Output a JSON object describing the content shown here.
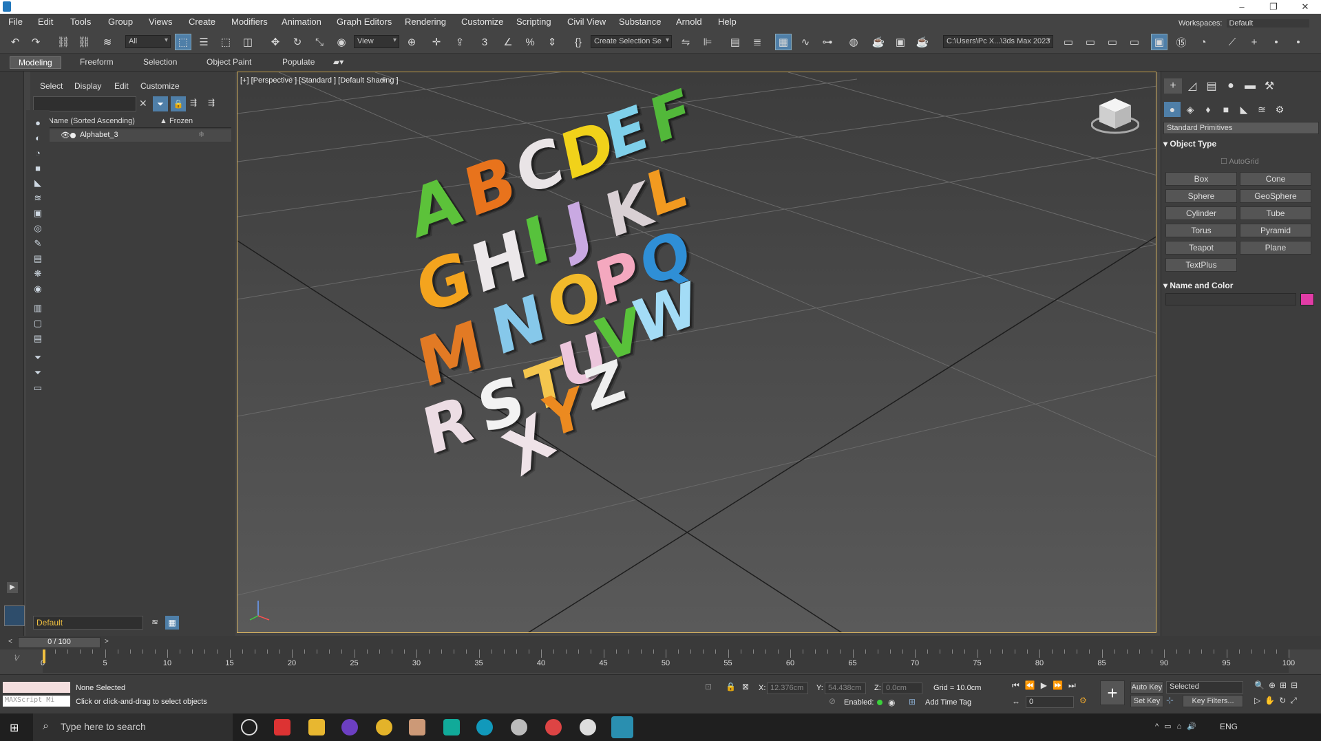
{
  "menubar": {
    "items": [
      "File",
      "Edit",
      "Tools",
      "Group",
      "Views",
      "Create",
      "Modifiers",
      "Animation",
      "Graph Editors",
      "Rendering",
      "Customize",
      "Scripting",
      "Civil View",
      "Substance",
      "Arnold",
      "Help"
    ],
    "workspaces_label": "Workspaces:",
    "workspaces_value": "Default"
  },
  "toolbar": {
    "selection_filter": "All",
    "reference_coord": "View",
    "named_selection": "Create Selection Se",
    "project_path": "C:\\Users\\Pc X...\\3ds Max 2023"
  },
  "ribbon": {
    "tabs": [
      "Modeling",
      "Freeform",
      "Selection",
      "Object Paint",
      "Populate"
    ],
    "active_tab": "Modeling"
  },
  "scene_explorer": {
    "menu": [
      "Select",
      "Display",
      "Edit",
      "Customize"
    ],
    "search_placeholder": "",
    "col_name": "Name (Sorted Ascending)",
    "col_frozen": "▲ Frozen",
    "rows": [
      {
        "name": "Alphabet_3"
      }
    ],
    "layer": "Default"
  },
  "viewport": {
    "label": "[+] [Perspective ] [Standard ] [Default Shading ]",
    "letters": [
      {
        "ch": "A",
        "color": "#5cc23a"
      },
      {
        "ch": "B",
        "color": "#e8731c"
      },
      {
        "ch": "C",
        "color": "#e9e4e6"
      },
      {
        "ch": "D",
        "color": "#f1d21a"
      },
      {
        "ch": "E",
        "color": "#7fd0ea"
      },
      {
        "ch": "F",
        "color": "#52b83a"
      },
      {
        "ch": "G",
        "color": "#f4a41e"
      },
      {
        "ch": "H",
        "color": "#ece8ea"
      },
      {
        "ch": "I",
        "color": "#57c23c"
      },
      {
        "ch": "J",
        "color": "#c9a9e2"
      },
      {
        "ch": "K",
        "color": "#d9d0d4"
      },
      {
        "ch": "L",
        "color": "#f29a20"
      },
      {
        "ch": "M",
        "color": "#e27a24"
      },
      {
        "ch": "N",
        "color": "#86c8ea"
      },
      {
        "ch": "O",
        "color": "#f2ba2a"
      },
      {
        "ch": "P",
        "color": "#f4a8bf"
      },
      {
        "ch": "Q",
        "color": "#2f8fd6"
      },
      {
        "ch": "R",
        "color": "#ecdde4"
      },
      {
        "ch": "S",
        "color": "#f2f2f2"
      },
      {
        "ch": "T",
        "color": "#f4c64e"
      },
      {
        "ch": "U",
        "color": "#ecc6dc"
      },
      {
        "ch": "V",
        "color": "#59c23a"
      },
      {
        "ch": "W",
        "color": "#a3dcf6"
      },
      {
        "ch": "X",
        "color": "#efe3e8"
      },
      {
        "ch": "Y",
        "color": "#ec8a20"
      },
      {
        "ch": "Z",
        "color": "#efefef"
      }
    ]
  },
  "command_panel": {
    "category": "Standard Primitives",
    "object_type_title": "Object Type",
    "autogrid": "AutoGrid",
    "buttons": [
      "Box",
      "Cone",
      "Sphere",
      "GeoSphere",
      "Cylinder",
      "Tube",
      "Torus",
      "Pyramid",
      "Teapot",
      "Plane",
      "TextPlus"
    ],
    "name_color_title": "Name and Color",
    "swatch_color": "#e23ca6"
  },
  "timeline": {
    "frame_display": "0 / 100",
    "ticks": [
      0,
      5,
      10,
      15,
      20,
      25,
      30,
      35,
      40,
      45,
      50,
      55,
      60,
      65,
      70,
      75,
      80,
      85,
      90,
      95,
      100
    ]
  },
  "status": {
    "selection": "None Selected",
    "prompt": "Click or click-and-drag to select objects",
    "maxscript": "MAXScript Mi",
    "x_label": "X:",
    "x_value": "12.376cm",
    "y_label": "Y:",
    "y_value": "54.438cm",
    "z_label": "Z:",
    "z_value": "0.0cm",
    "grid": "Grid = 10.0cm",
    "enabled_label": "Enabled:",
    "add_time_tag": "Add Time Tag",
    "auto_key": "Auto Key",
    "set_key": "Set Key",
    "key_mode": "Selected",
    "key_filters": "Key Filters...",
    "frame_field": "0"
  },
  "taskbar": {
    "search_placeholder": "Type here to search",
    "lang": "ENG"
  }
}
